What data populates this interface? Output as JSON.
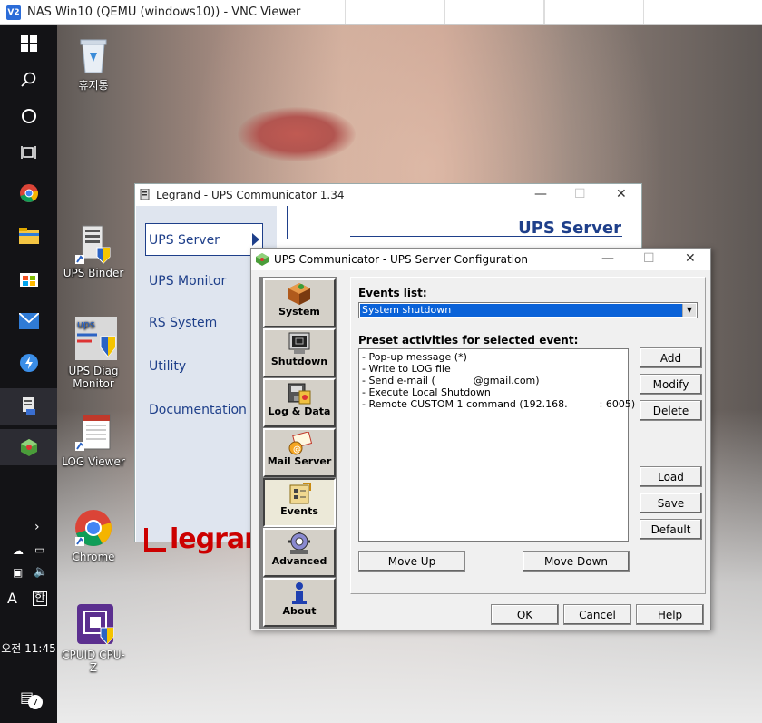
{
  "vnc": {
    "title": "NAS Win10 (QEMU (windows10)) - VNC Viewer",
    "logo": "V2"
  },
  "taskbar": {
    "time": "오전 11:45",
    "ime_a": "A",
    "ime_han": "한",
    "notification_count": "7"
  },
  "desktop_icons": {
    "recycle": "휴지통",
    "ups_binder": "UPS Binder",
    "ups_diag": "UPS Diag Monitor",
    "log_viewer": "LOG Viewer",
    "chrome": "Chrome",
    "cpuz": "CPUID CPU-Z"
  },
  "legrand": {
    "title": "Legrand - UPS Communicator 1.34",
    "header": "UPS Server",
    "menu": [
      "UPS Server",
      "UPS Monitor",
      "RS System",
      "Utility",
      "Documentation"
    ],
    "logo_text": "legran"
  },
  "config": {
    "title": "UPS Communicator - UPS Server Configuration",
    "sidebar": [
      "System",
      "Shutdown",
      "Log & Data",
      "Mail Server",
      "Events",
      "Advanced",
      "About"
    ],
    "events_label": "Events list:",
    "selected_event": "System shutdown",
    "preset_label": "Preset activities for selected event:",
    "activities": [
      "- Pop-up message (*)",
      "- Write to LOG file",
      "- Send e-mail (            @gmail.com)",
      "- Execute Local Shutdown",
      "- Remote CUSTOM 1 command (192.168.          : 6005)"
    ],
    "buttons": {
      "add": "Add",
      "modify": "Modify",
      "delete": "Delete",
      "load": "Load",
      "save": "Save",
      "default": "Default",
      "move_up": "Move Up",
      "move_down": "Move Down",
      "ok": "OK",
      "cancel": "Cancel",
      "help": "Help"
    }
  }
}
